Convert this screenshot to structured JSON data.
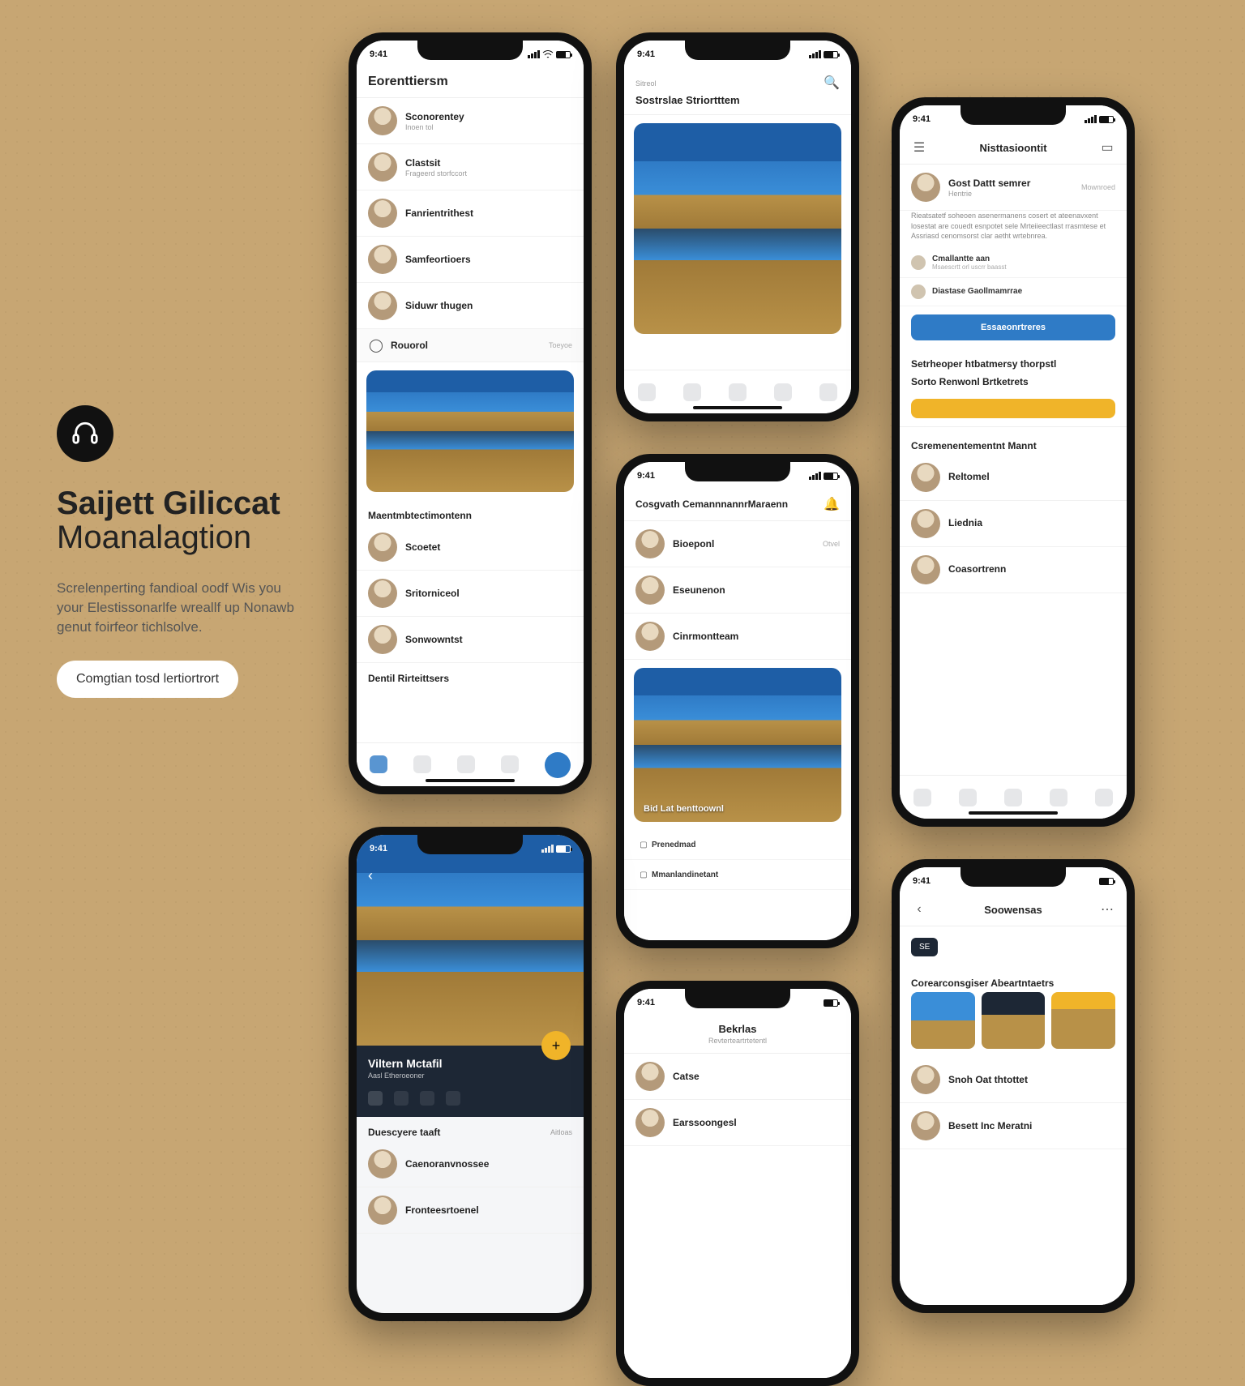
{
  "sidebar": {
    "title_line1": "Saijett Giliccat",
    "title_line2": "Moanalagtion",
    "blurb": "Screlenperting fandioal oodf Wis you your Elestissonarlfe wreallf up Nonawb genut foirfeor tichlsolve.",
    "cta": "Comgtian tosd lertiortrort"
  },
  "status": {
    "time": "9:41"
  },
  "phone1": {
    "header": "Eorenttiersm",
    "items": [
      {
        "name": "Sconorentey",
        "sub": "Inoen tol",
        "meta": ""
      },
      {
        "name": "Clastsit",
        "sub": "Frageerd storfccort",
        "meta": ""
      },
      {
        "name": "Fanrientrithest",
        "sub": "",
        "meta": ""
      },
      {
        "name": "Samfeortioers",
        "sub": "",
        "meta": ""
      },
      {
        "name": "Siduwr thugen",
        "sub": "",
        "meta": ""
      }
    ],
    "footer_item": {
      "name": "Rouorol",
      "meta": "Toeyoe"
    },
    "section2": "Maentmbtectimontenn",
    "items2": [
      {
        "name": "Scoetet",
        "meta": ""
      },
      {
        "name": "Sritorniceol",
        "meta": ""
      },
      {
        "name": "Sonwowntst",
        "meta": ""
      }
    ],
    "section3": "Dentil Rirteittsers"
  },
  "phone2": {
    "back_label": "Sitreol",
    "header": "Sostrslae Striortttem",
    "tabs": [
      "",
      "",
      "",
      "",
      ""
    ]
  },
  "phone3": {
    "header": "Cosgvath CemannnannrMaraenn",
    "items": [
      {
        "name": "Bioeponl",
        "meta": "Otvel"
      },
      {
        "name": "Eseunenon",
        "meta": ""
      },
      {
        "name": "Cinrmontteam",
        "meta": ""
      }
    ],
    "caption": "Bid Lat benttoownl",
    "row_label": "Prenedmad",
    "row2_label": "Mmanlandinetant"
  },
  "phone4": {
    "header": "Nisttasioontit",
    "author": "Gost Dattt semrer",
    "author_sub": "Hentrie",
    "author_meta": "Mownroed",
    "para": "Rieatsatetf soheoen asenermanens cosert et ateenavxent losestat are couedt esnpotet sele Mrteiieectlast rrasmtese et Assriasd cenomsorst clar aetht wrtebnrea.",
    "opt1": "Cmallantte aan",
    "opt1_sub": "Msaescrtt orl uscrr baasst",
    "opt2": "Diastase Gaollmamrrae",
    "opt2_sub": "",
    "primary_btn": "Essaeonrtreres",
    "section2": "Setrheoper htbatmersy thorpstl",
    "section3": "Sorto Renwonl Brtketrets",
    "gold_btn": "",
    "list_title": "Csremenentementnt Mannt",
    "items": [
      {
        "name": "Reltomel",
        "meta": ""
      },
      {
        "name": "Liednia",
        "meta": ""
      },
      {
        "name": "Coasortrenn",
        "meta": ""
      }
    ]
  },
  "phone5": {
    "profile_name": "Viltern Mctafil",
    "profile_sub": "Aasl Etheroeoner",
    "seg": [
      "",
      "",
      "",
      ""
    ],
    "section": "Duescyere taaft",
    "section_meta": "Aitloas",
    "items": [
      {
        "name": "Caenoranvnossee",
        "meta": ""
      },
      {
        "name": "Fronteesrtoenel",
        "meta": ""
      }
    ]
  },
  "phone6": {
    "header": "Bekrlas",
    "sub": "Revterteartrtetentl",
    "items": [
      {
        "name": "Catse",
        "meta": ""
      },
      {
        "name": "Earssoongesl",
        "meta": ""
      }
    ]
  },
  "phone7": {
    "header": "Soowensas",
    "badge": "SE",
    "section": "Corearconsgiser Abeartntaetrs",
    "items": [
      {
        "name": "Snoh Oat thtottet",
        "meta": ""
      },
      {
        "name": "Besett Inc Meratni",
        "meta": ""
      }
    ]
  }
}
